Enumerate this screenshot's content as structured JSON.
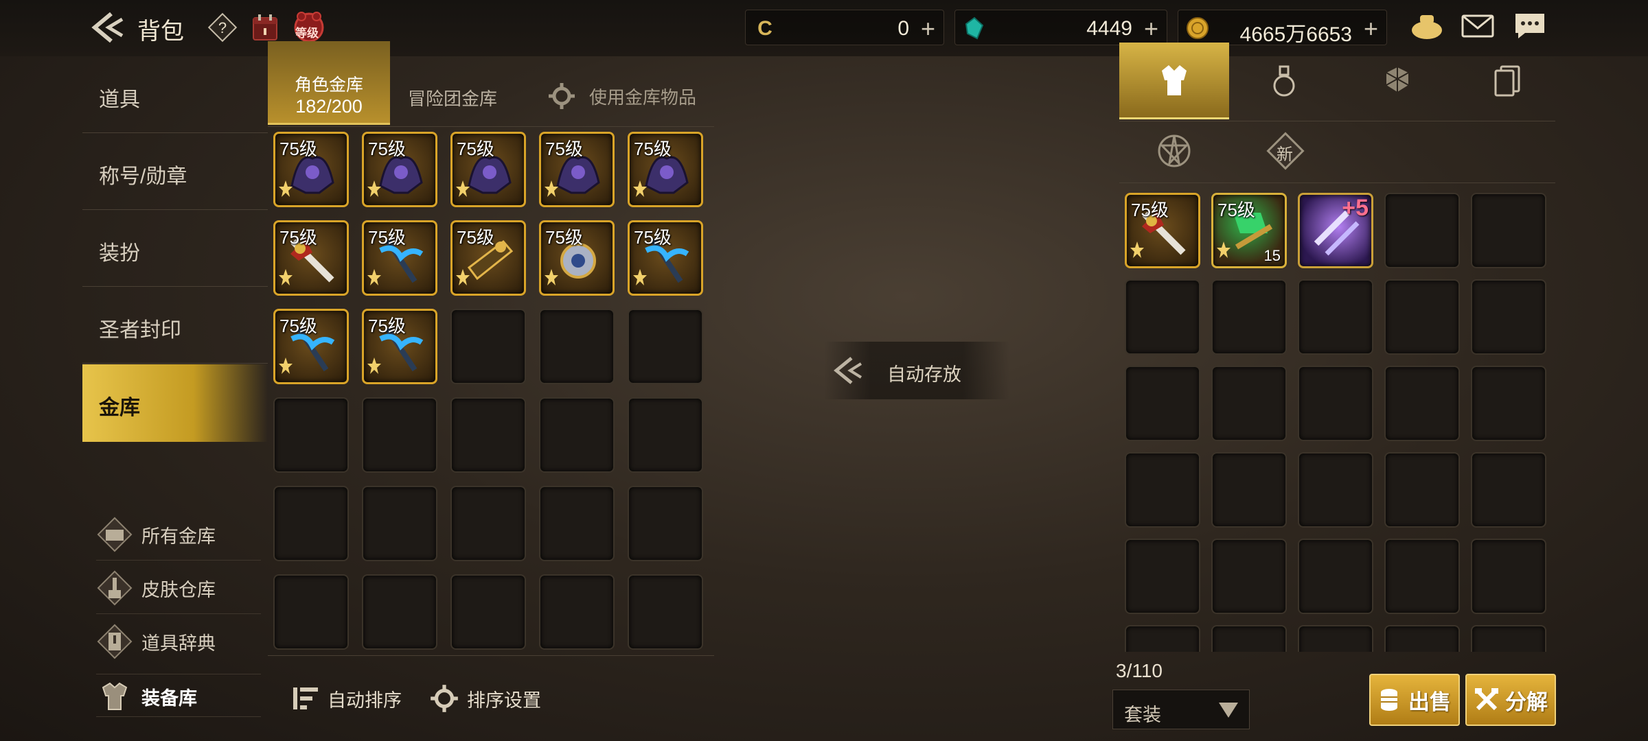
{
  "header": {
    "title": "背包",
    "level_badge": "等级"
  },
  "currencies": [
    {
      "icon": "coin-c-icon",
      "value": "0"
    },
    {
      "icon": "gem-icon",
      "value": "4449"
    },
    {
      "icon": "gold-coin-icon",
      "value": "4665万6653"
    }
  ],
  "left_nav": {
    "items": [
      {
        "label": "道具",
        "active": false
      },
      {
        "label": "称号/勋章",
        "active": false
      },
      {
        "label": "装扮",
        "active": false
      },
      {
        "label": "圣者封印",
        "active": false
      },
      {
        "label": "金库",
        "active": true
      }
    ],
    "sub_items": [
      {
        "label": "所有金库",
        "icon": "vault-icon"
      },
      {
        "label": "皮肤仓库",
        "icon": "brush-icon"
      },
      {
        "label": "道具辞典",
        "icon": "dictionary-icon"
      },
      {
        "label": "装备库",
        "icon": "armor-icon"
      }
    ]
  },
  "storage_tabs": {
    "active_label": "角色金库",
    "active_count": "182/200",
    "adventure_label": "冒险团金库",
    "use_label": "使用金库物品"
  },
  "storage_items": [
    {
      "level": "75级",
      "kind": "dark"
    },
    {
      "level": "75级",
      "kind": "dark"
    },
    {
      "level": "75级",
      "kind": "dark"
    },
    {
      "level": "75级",
      "kind": "dark"
    },
    {
      "level": "75级",
      "kind": "dark"
    },
    {
      "level": "75级",
      "kind": "red"
    },
    {
      "level": "75级",
      "kind": "blue"
    },
    {
      "level": "75级",
      "kind": "gold"
    },
    {
      "level": "75级",
      "kind": "silver"
    },
    {
      "level": "75级",
      "kind": "blue"
    },
    {
      "level": "75级",
      "kind": "blue"
    },
    {
      "level": "75级",
      "kind": "blue"
    }
  ],
  "auto_store_label": "自动存放",
  "bottom_actions": {
    "auto_sort": "自动排序",
    "sort_settings": "排序设置"
  },
  "inventory": {
    "badge_new": "新",
    "count": "3/110",
    "filter_selected": "套装",
    "items": [
      {
        "level": "75级",
        "kind": "red",
        "qty": ""
      },
      {
        "level": "75级",
        "kind": "green",
        "qty": "15"
      },
      {
        "level": "",
        "kind": "purple",
        "qty": "",
        "enhance": "+5"
      }
    ],
    "sell_label": "出售",
    "disassemble_label": "分解"
  },
  "colors": {
    "accent_gold": "#d9a428",
    "bg_dark": "#1b1612"
  }
}
